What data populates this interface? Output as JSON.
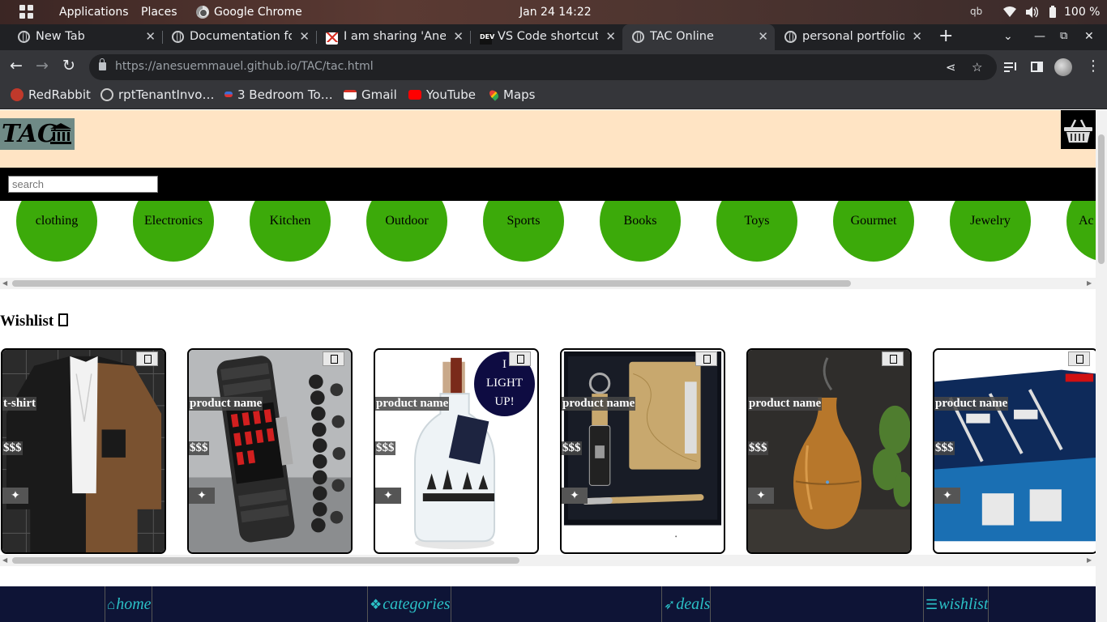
{
  "topbar": {
    "applications": "Applications",
    "places": "Places",
    "active_app": "Google Chrome",
    "clock": "Jan 24  14:22",
    "tray_kb": "qb",
    "battery": "100 %"
  },
  "tabs": [
    {
      "label": "New Tab",
      "icon": "chrome-icon"
    },
    {
      "label": "Documentation for",
      "icon": "globe-icon"
    },
    {
      "label": "I am sharing 'Anes",
      "icon": "gmail-icon"
    },
    {
      "label": "VS Code shortcuts",
      "icon": "dev-icon"
    },
    {
      "label": "TAC Online",
      "icon": "globe-icon",
      "active": true
    },
    {
      "label": "personal portfolio",
      "icon": "globe-icon"
    }
  ],
  "address": {
    "url_host": "https://anesuemmauel.github.io",
    "url_path": "/TAC/tac.html"
  },
  "bookmarks": [
    {
      "label": "RedRabbit",
      "icon": "redrabbit-icon"
    },
    {
      "label": "rptTenantInvo…",
      "icon": "globe-icon"
    },
    {
      "label": "3 Bedroom To…",
      "icon": "house-icon"
    },
    {
      "label": "Gmail",
      "icon": "gmail-icon"
    },
    {
      "label": "YouTube",
      "icon": "youtube-icon"
    },
    {
      "label": "Maps",
      "icon": "maps-icon"
    }
  ],
  "site": {
    "logo_text": "TAC",
    "search_placeholder": "search",
    "categories": [
      "clothing",
      "Electronics",
      "Kitchen",
      "Outdoor",
      "Sports",
      "Books",
      "Toys",
      "Gourmet",
      "Jewelry",
      "Ac"
    ],
    "wishlist_title": "Wishlist",
    "products": [
      {
        "name": "t-shirt",
        "price": "$$$",
        "image": "shirt"
      },
      {
        "name": "product name",
        "price": "$$$",
        "image": "watch"
      },
      {
        "name": "product name",
        "price": "$$$",
        "image": "bottle",
        "badge": "I LIGHT UP!"
      },
      {
        "name": "product name",
        "price": "$$$",
        "image": "gift-set"
      },
      {
        "name": "product name",
        "price": "$$$",
        "image": "diffuser"
      },
      {
        "name": "product name",
        "price": "$$$",
        "image": "lego"
      }
    ],
    "bottom_nav": [
      "home",
      "categories",
      "deals",
      "wishlist"
    ]
  },
  "colors": {
    "header_bg": "#ffe4c4",
    "category_green": "#3caa0a",
    "bottom_nav_bg": "#0e1436",
    "bottom_nav_text": "#2bc0c6"
  }
}
